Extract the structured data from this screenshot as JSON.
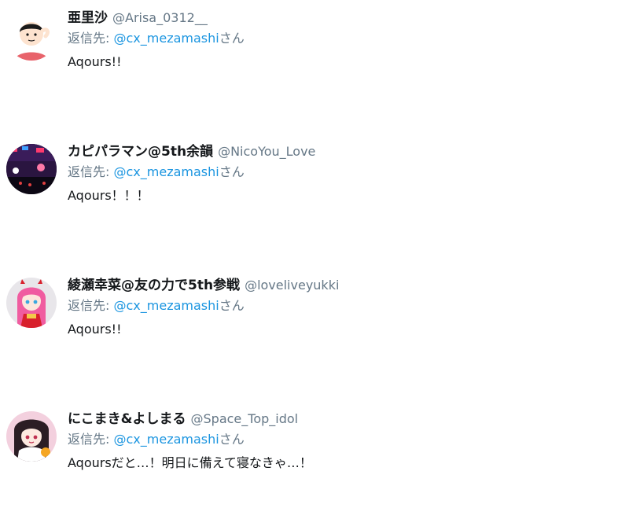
{
  "reply_to_prefix": "返信先:",
  "reply_to_suffix": "さん",
  "replies": [
    {
      "display_name": "亜里沙",
      "handle": "@Arisa_0312__",
      "reply_to": "@cx_mezamashi",
      "text": "Aqours!!"
    },
    {
      "display_name": "カピパラマン@5th余韻",
      "handle": "@NicoYou_Love",
      "reply_to": "@cx_mezamashi",
      "text": "Aqours！！！"
    },
    {
      "display_name": "綾瀬幸菜@友の力で5th参戦",
      "handle": "@loveliveyukki",
      "reply_to": "@cx_mezamashi",
      "text": "Aqours!!"
    },
    {
      "display_name": "にこまき&よしまる",
      "handle": "@Space_Top_idol",
      "reply_to": "@cx_mezamashi",
      "text": "Aqoursだと…！明日に備えて寝なきゃ…！"
    }
  ]
}
